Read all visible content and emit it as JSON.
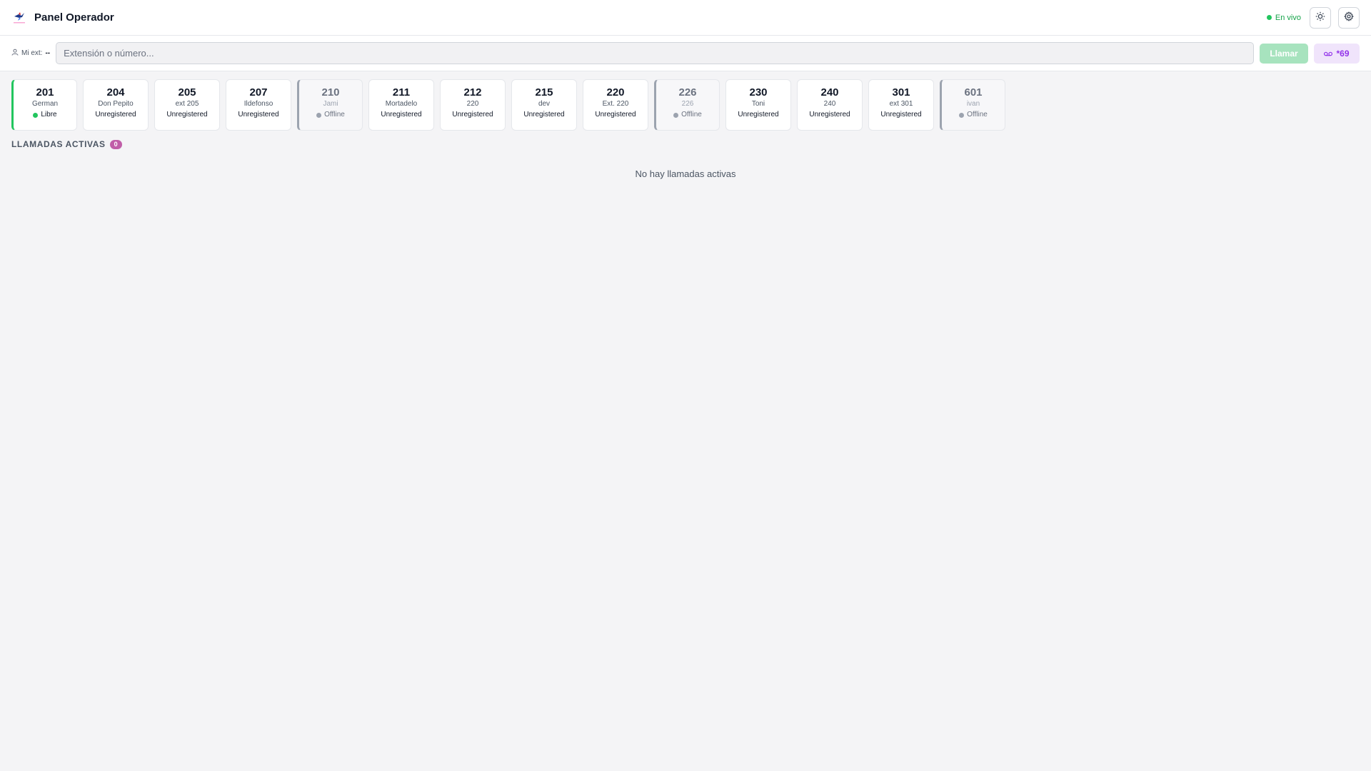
{
  "header": {
    "title": "Panel Operador",
    "live_label": "En vivo",
    "theme_icon": "sun-icon",
    "settings_icon": "gear-icon",
    "logo_icon": "bird-logo-icon"
  },
  "dialbar": {
    "my_ext_label": "Mi ext:",
    "my_ext_value": "--",
    "input_placeholder": "Extensión o número...",
    "input_value": "",
    "call_label": "Llamar",
    "voicemail_label": "*69",
    "voicemail_icon": "voicemail-icon"
  },
  "extensions": [
    {
      "number": "201",
      "name": "German",
      "status": "Libre",
      "state": "free"
    },
    {
      "number": "204",
      "name": "Don Pepito",
      "status": "Unregistered",
      "state": "unregistered"
    },
    {
      "number": "205",
      "name": "ext 205",
      "status": "Unregistered",
      "state": "unregistered"
    },
    {
      "number": "207",
      "name": "Ildefonso",
      "status": "Unregistered",
      "state": "unregistered"
    },
    {
      "number": "210",
      "name": "Jami",
      "status": "Offline",
      "state": "offline"
    },
    {
      "number": "211",
      "name": "Mortadelo",
      "status": "Unregistered",
      "state": "unregistered"
    },
    {
      "number": "212",
      "name": "220",
      "status": "Unregistered",
      "state": "unregistered"
    },
    {
      "number": "215",
      "name": "dev",
      "status": "Unregistered",
      "state": "unregistered"
    },
    {
      "number": "220",
      "name": "Ext. 220",
      "status": "Unregistered",
      "state": "unregistered"
    },
    {
      "number": "226",
      "name": "226",
      "status": "Offline",
      "state": "offline"
    },
    {
      "number": "230",
      "name": "Toni",
      "status": "Unregistered",
      "state": "unregistered"
    },
    {
      "number": "240",
      "name": "240",
      "status": "Unregistered",
      "state": "unregistered"
    },
    {
      "number": "301",
      "name": "ext 301",
      "status": "Unregistered",
      "state": "unregistered"
    },
    {
      "number": "601",
      "name": "ivan",
      "status": "Offline",
      "state": "offline"
    }
  ],
  "active_calls": {
    "title": "LLAMADAS ACTIVAS",
    "count": "0",
    "empty_message": "No hay llamadas activas"
  },
  "colors": {
    "free": "#22c55e",
    "offline": "#9ca3af",
    "live": "#16a34a",
    "badge": "#c05ea8",
    "call_button": "#a7e3be",
    "voicemail_button": "#f0e4fb"
  }
}
